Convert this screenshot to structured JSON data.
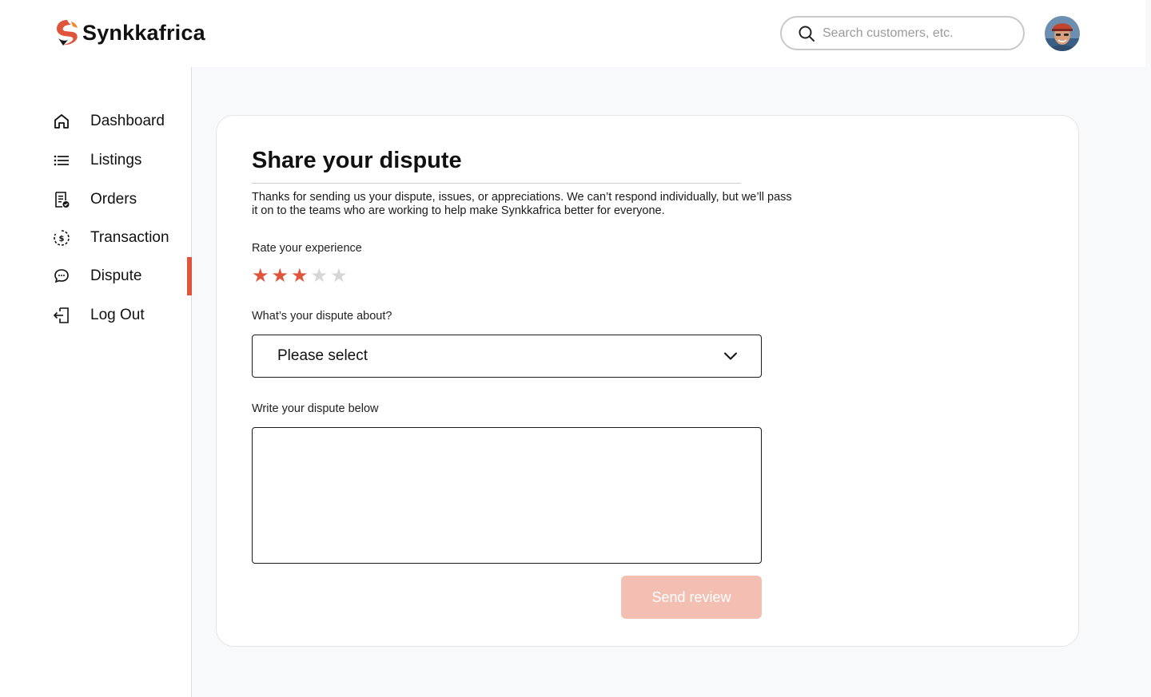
{
  "brand": {
    "name": "Synkkafrica",
    "logo_icon": "pin-logo-icon",
    "accent": "#e1543c"
  },
  "search": {
    "placeholder": "Search customers, etc.",
    "value": "",
    "icon": "search-icon"
  },
  "avatar": {
    "icon": "user-avatar"
  },
  "sidebar": {
    "items": [
      {
        "label": "Dashboard",
        "icon": "home-icon",
        "active": false
      },
      {
        "label": "Listings",
        "icon": "list-icon",
        "active": false
      },
      {
        "label": "Orders",
        "icon": "orders-icon",
        "active": false
      },
      {
        "label": "Transaction",
        "icon": "dollar-cycle-icon",
        "active": false
      },
      {
        "label": "Dispute",
        "icon": "chat-bubble-icon",
        "active": true
      },
      {
        "label": "Log Out",
        "icon": "logout-icon",
        "active": false
      }
    ]
  },
  "form": {
    "title": "Share your dispute",
    "intro": "Thanks for sending us your dispute, issues, or appreciations. We can’t respond individually, but we’ll pass it on to the teams who are working to help make Synkkafrica better for everyone.",
    "rating_label": "Rate your experience",
    "rating": 3,
    "rating_max": 5,
    "star_filled_color": "#e1543c",
    "star_empty_color": "#d6d6d6",
    "topic_label": "What’s your dispute about?",
    "topic_value": "Please select",
    "message_label": "Write your dispute below",
    "message_value": "",
    "submit_label": "Send review",
    "submit_color": "#f3bfb3"
  }
}
